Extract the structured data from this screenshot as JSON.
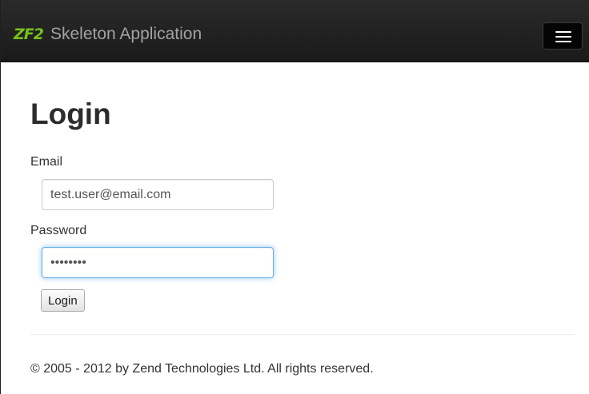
{
  "navbar": {
    "logo": "ZF2",
    "brand": "Skeleton Application",
    "toggle_icon": "hamburger-menu-icon"
  },
  "page": {
    "title": "Login"
  },
  "form": {
    "email_label": "Email",
    "email_value": "test.user@email.com",
    "password_label": "Password",
    "password_value": "12345678",
    "submit_label": "Login"
  },
  "footer": {
    "text": "© 2005 - 2012 by Zend Technologies Ltd. All rights reserved."
  },
  "colors": {
    "navbar_bg": "#1f1f1f",
    "logo_green": "#79c01b",
    "focus_blue": "#66afe9"
  }
}
